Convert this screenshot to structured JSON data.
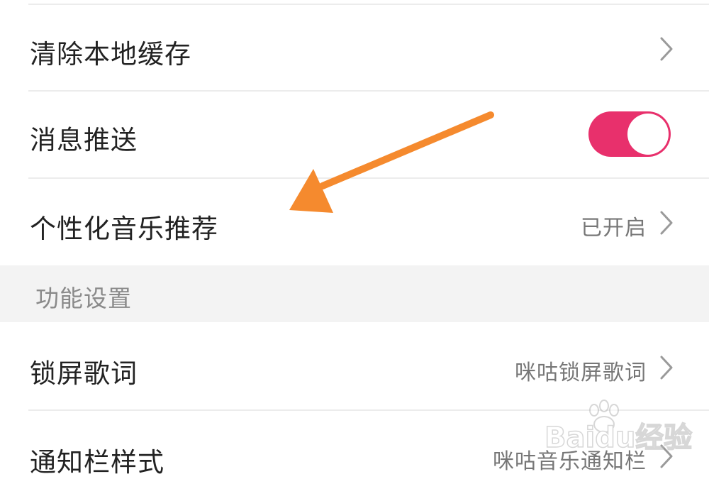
{
  "settings": {
    "clear_cache": {
      "label": "清除本地缓存"
    },
    "push": {
      "label": "消息推送",
      "enabled": true
    },
    "personalized": {
      "label": "个性化音乐推荐",
      "value": "已开启"
    },
    "section_title": "功能设置",
    "lock_lyrics": {
      "label": "锁屏歌词",
      "value": "咪咕锁屏歌词"
    },
    "notification": {
      "label": "通知栏样式",
      "value": "咪咕音乐通知栏"
    }
  },
  "colors": {
    "toggle_on": "#e8306c",
    "arrow": "#f58a2e",
    "section_bg": "#f3f3f3"
  },
  "icons": {
    "chevron": "chevron-right-icon",
    "annotation": "arrow-annotation",
    "watermark": "paw-icon"
  },
  "watermark": {
    "text": "Baidu经验"
  }
}
